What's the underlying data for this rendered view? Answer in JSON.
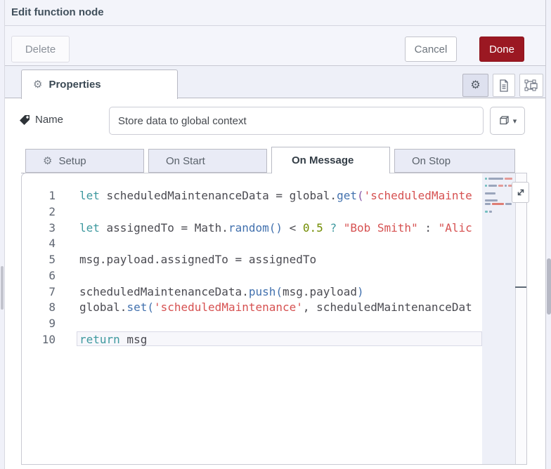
{
  "window": {
    "title": "Edit function node"
  },
  "toolbar": {
    "delete": "Delete",
    "cancel": "Cancel",
    "done": "Done"
  },
  "properties_tab": {
    "label": "Properties"
  },
  "name_row": {
    "label": "Name",
    "value": "Store data to global context"
  },
  "func_tabs": [
    {
      "label": "Setup"
    },
    {
      "label": "On Start"
    },
    {
      "label": "On Message"
    },
    {
      "label": "On Stop"
    }
  ],
  "colors": {
    "done_button_bg": "#9B1822",
    "panel_bg": "#EEF0F8",
    "border": "#B8B9C3"
  },
  "editor": {
    "active_line": 10,
    "colors": {
      "kw": "#3E999F",
      "id": "#4B4B52",
      "op": "#4B4B52",
      "fn": "#4271AE",
      "br": "#4271AE",
      "br2": "#8959A8",
      "str": "#D65151",
      "num": "#718C00"
    },
    "lines": [
      {
        "num": 1,
        "tokens": [
          {
            "t": "let",
            "c": "kw"
          },
          {
            "t": " scheduledMaintenanceData ",
            "c": "id"
          },
          {
            "t": "= ",
            "c": "op"
          },
          {
            "t": "global",
            "c": "id"
          },
          {
            "t": ".",
            "c": "op"
          },
          {
            "t": "get",
            "c": "fn"
          },
          {
            "t": "(",
            "c": "br2"
          },
          {
            "t": "'scheduledMainte",
            "c": "str"
          }
        ]
      },
      {
        "num": 2,
        "tokens": []
      },
      {
        "num": 3,
        "tokens": [
          {
            "t": "let",
            "c": "kw"
          },
          {
            "t": " assignedTo ",
            "c": "id"
          },
          {
            "t": "= ",
            "c": "op"
          },
          {
            "t": "Math",
            "c": "id"
          },
          {
            "t": ".",
            "c": "op"
          },
          {
            "t": "random",
            "c": "fn"
          },
          {
            "t": "()",
            "c": "br"
          },
          {
            "t": " < ",
            "c": "op"
          },
          {
            "t": "0.5",
            "c": "num"
          },
          {
            "t": " ",
            "c": "op"
          },
          {
            "t": "?",
            "c": "kw"
          },
          {
            "t": " ",
            "c": "op"
          },
          {
            "t": "\"Bob Smith\"",
            "c": "str"
          },
          {
            "t": " : ",
            "c": "op"
          },
          {
            "t": "\"Alic",
            "c": "str"
          }
        ]
      },
      {
        "num": 4,
        "tokens": []
      },
      {
        "num": 5,
        "tokens": [
          {
            "t": "msg.payload.assignedTo = assignedTo",
            "c": "id"
          }
        ]
      },
      {
        "num": 6,
        "tokens": []
      },
      {
        "num": 7,
        "tokens": [
          {
            "t": "scheduledMaintenanceData",
            "c": "id"
          },
          {
            "t": ".",
            "c": "op"
          },
          {
            "t": "push",
            "c": "fn"
          },
          {
            "t": "(",
            "c": "br"
          },
          {
            "t": "msg.payload",
            "c": "id"
          },
          {
            "t": ")",
            "c": "br"
          }
        ]
      },
      {
        "num": 8,
        "tokens": [
          {
            "t": "global",
            "c": "id"
          },
          {
            "t": ".",
            "c": "op"
          },
          {
            "t": "set",
            "c": "fn"
          },
          {
            "t": "(",
            "c": "br"
          },
          {
            "t": "'scheduledMaintenance'",
            "c": "str"
          },
          {
            "t": ", ",
            "c": "op"
          },
          {
            "t": "scheduledMaintenanceDat",
            "c": "id"
          }
        ]
      },
      {
        "num": 9,
        "tokens": []
      },
      {
        "num": 10,
        "tokens": [
          {
            "t": "return",
            "c": "kw"
          },
          {
            "t": " msg",
            "c": "id"
          }
        ]
      }
    ],
    "minimap_colors": {
      "g": "#9AA5BC",
      "r": "#E49A97",
      "R": "#DD7D74",
      "t": "#74BFC0"
    },
    "minimap_rows": [
      {
        "line": 1,
        "segs": [
          [
            3,
            "t"
          ],
          [
            21,
            "g"
          ],
          [
            11,
            "r"
          ]
        ]
      },
      {
        "line": 3,
        "segs": [
          [
            3,
            "t"
          ],
          [
            12,
            "g"
          ],
          [
            7,
            "r"
          ],
          [
            3,
            "g"
          ],
          [
            7,
            "r"
          ]
        ]
      },
      {
        "line": 5,
        "segs": [
          [
            15,
            "g"
          ]
        ]
      },
      {
        "line": 7,
        "segs": [
          [
            18,
            "g"
          ]
        ]
      },
      {
        "line": 8,
        "segs": [
          [
            8,
            "g"
          ],
          [
            17,
            "R"
          ],
          [
            9,
            "g"
          ]
        ]
      },
      {
        "line": 10,
        "segs": [
          [
            4,
            "t"
          ],
          [
            4,
            "g"
          ]
        ]
      }
    ]
  }
}
